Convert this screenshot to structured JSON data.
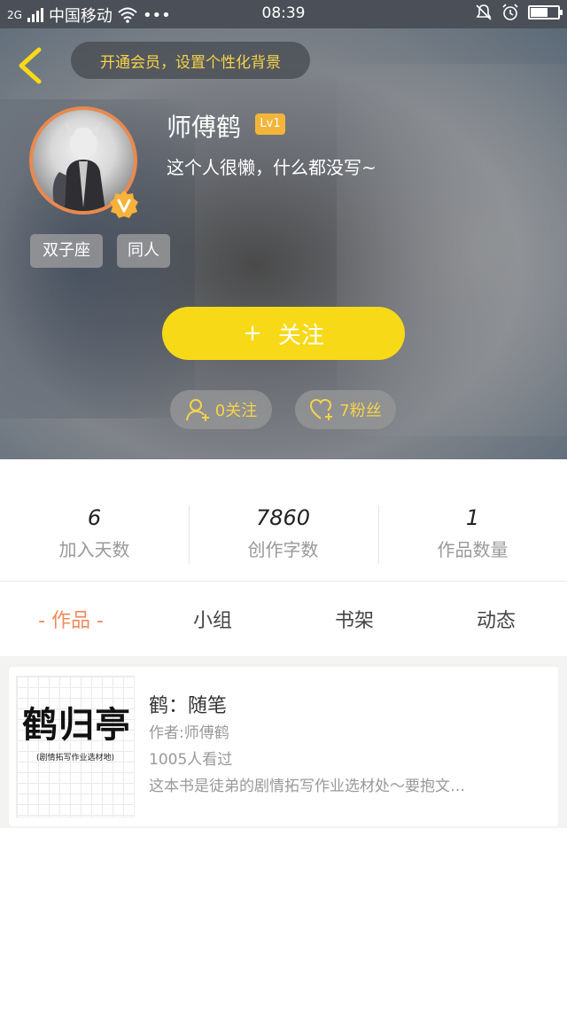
{
  "status_bar": {
    "network": "2G",
    "carrier": "中国移动",
    "time": "08:39",
    "icons": [
      "signal-icon",
      "wifi-icon",
      "more-dots-icon",
      "mute-icon",
      "alarm-icon",
      "battery-icon"
    ],
    "battery_level": 0.6
  },
  "header": {
    "vip_banner": "开通会员，设置个性化背景",
    "username": "师傅鹤",
    "level": "Lv1",
    "bio": "这个人很懒，什么都没写~",
    "tags": [
      "双子座",
      "同人"
    ],
    "follow_plus": "+",
    "follow_label": "关注",
    "following_label": "0关注",
    "fans_label": "7粉丝",
    "accent_color": "#f8d917"
  },
  "stats": [
    {
      "value": "6",
      "label": "加入天数"
    },
    {
      "value": "7860",
      "label": "创作字数"
    },
    {
      "value": "1",
      "label": "作品数量"
    }
  ],
  "tabs": [
    {
      "label": "- 作品 -",
      "active": true
    },
    {
      "label": "小组",
      "active": false
    },
    {
      "label": "书架",
      "active": false
    },
    {
      "label": "动态",
      "active": false
    }
  ],
  "works": [
    {
      "cover_title": "鹤归亭",
      "cover_subtitle": "(剧情拓写作业选材地)",
      "title": "鹤：随笔",
      "author": "作者:师傅鹤",
      "views": "1005人看过",
      "description": "这本书是徒弟的剧情拓写作业选材处～要抱文…"
    }
  ]
}
